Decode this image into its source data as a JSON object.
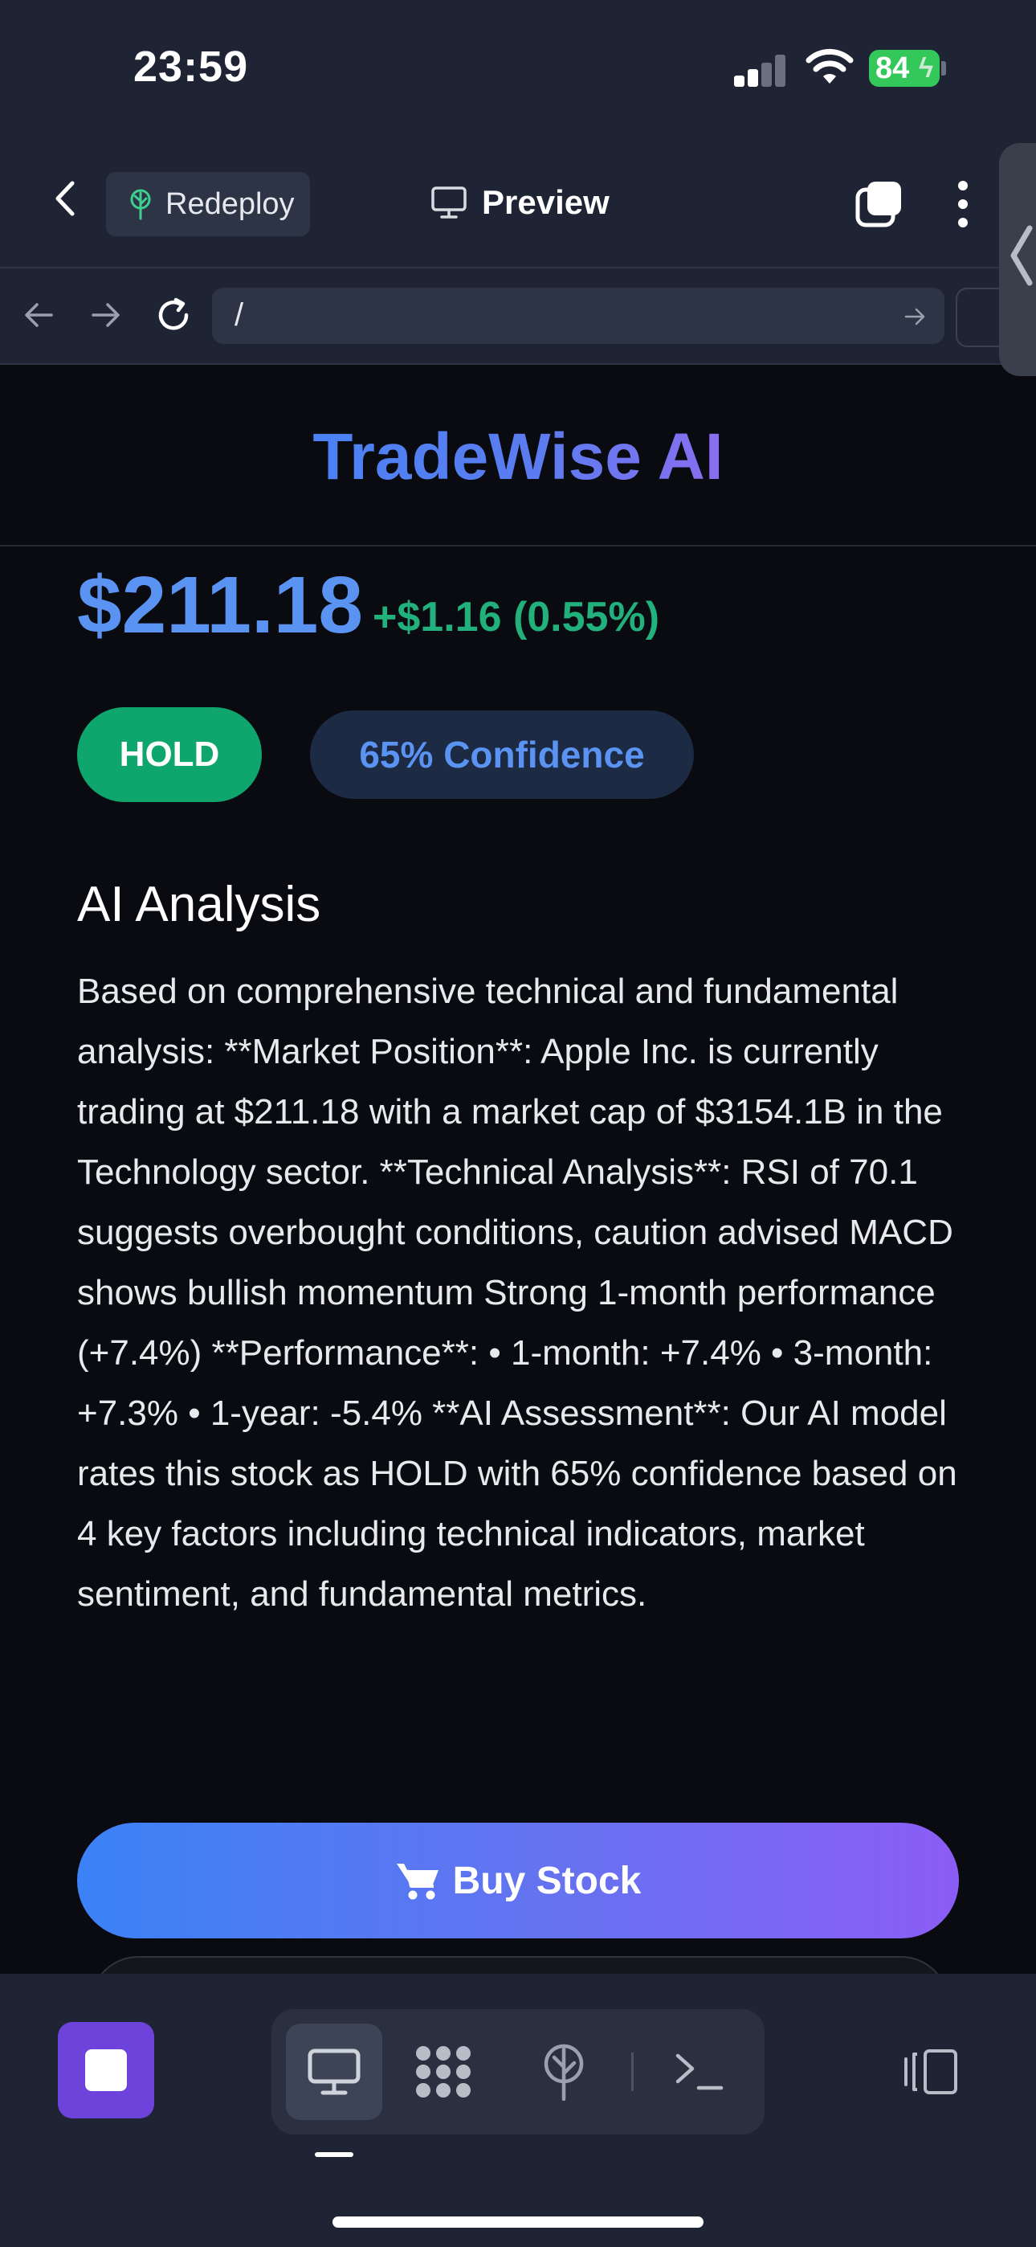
{
  "status_bar": {
    "time": "23:59",
    "battery_level": "84",
    "battery_color": "#34c759"
  },
  "toolbar": {
    "redeploy_label": "Redeploy",
    "preview_label": "Preview"
  },
  "urlbar": {
    "url": "/"
  },
  "app": {
    "brand": "TradeWise AI",
    "brand_gradient": [
      "#4a82f3",
      "#8a6ef0"
    ],
    "price": "$211.18",
    "change": "+$1.16 (0.55%)",
    "recommendation": "HOLD",
    "confidence": "65% Confidence",
    "analysis_title": "AI Analysis",
    "analysis_text": "Based on comprehensive technical and fundamental analysis: **Market Position**: Apple Inc. is currently trading at $211.18 with a market cap of $3154.1B in the Technology sector. **Technical Analysis**: RSI of 70.1 suggests overbought conditions, caution advised MACD shows bullish momentum Strong 1-month performance (+7.4%) **Performance**: • 1-month: +7.4% • 3-month: +7.3% • 1-year: -5.4% **AI Assessment**: Our AI model rates this stock as HOLD with 65% confidence based on 4 key factors including technical indicators, market sentiment, and fundamental metrics.",
    "buy_label": "Buy Stock",
    "colors": {
      "price": "#5a93f2",
      "change": "#22b07d",
      "hold": "#0ea66d",
      "buy_gradient": [
        "#3b82f6",
        "#8b5cf6"
      ]
    }
  },
  "bottom_bar": {
    "stop_color": "#6d43dc",
    "icons": [
      "monitor-icon",
      "grid-icon",
      "deploy-icon",
      "terminal-icon",
      "split-view-icon"
    ]
  }
}
